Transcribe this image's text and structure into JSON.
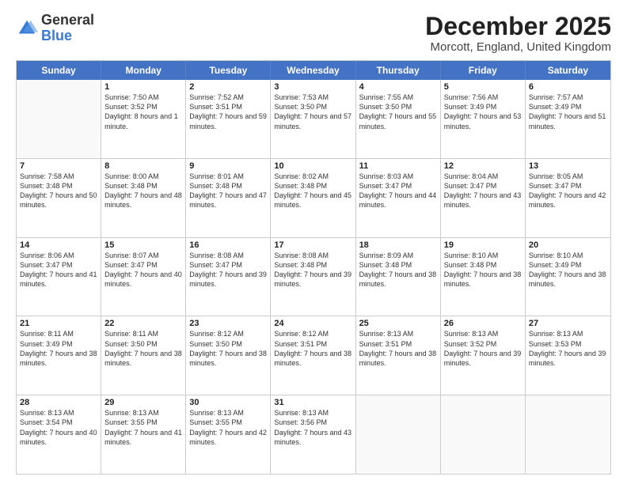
{
  "header": {
    "logo": {
      "general": "General",
      "blue": "Blue"
    },
    "title": "December 2025",
    "location": "Morcott, England, United Kingdom"
  },
  "days_of_week": [
    "Sunday",
    "Monday",
    "Tuesday",
    "Wednesday",
    "Thursday",
    "Friday",
    "Saturday"
  ],
  "weeks": [
    [
      {
        "day": "",
        "empty": true
      },
      {
        "day": "1",
        "sunrise": "Sunrise: 7:50 AM",
        "sunset": "Sunset: 3:52 PM",
        "daylight": "Daylight: 8 hours and 1 minute."
      },
      {
        "day": "2",
        "sunrise": "Sunrise: 7:52 AM",
        "sunset": "Sunset: 3:51 PM",
        "daylight": "Daylight: 7 hours and 59 minutes."
      },
      {
        "day": "3",
        "sunrise": "Sunrise: 7:53 AM",
        "sunset": "Sunset: 3:50 PM",
        "daylight": "Daylight: 7 hours and 57 minutes."
      },
      {
        "day": "4",
        "sunrise": "Sunrise: 7:55 AM",
        "sunset": "Sunset: 3:50 PM",
        "daylight": "Daylight: 7 hours and 55 minutes."
      },
      {
        "day": "5",
        "sunrise": "Sunrise: 7:56 AM",
        "sunset": "Sunset: 3:49 PM",
        "daylight": "Daylight: 7 hours and 53 minutes."
      },
      {
        "day": "6",
        "sunrise": "Sunrise: 7:57 AM",
        "sunset": "Sunset: 3:49 PM",
        "daylight": "Daylight: 7 hours and 51 minutes."
      }
    ],
    [
      {
        "day": "7",
        "sunrise": "Sunrise: 7:58 AM",
        "sunset": "Sunset: 3:48 PM",
        "daylight": "Daylight: 7 hours and 50 minutes."
      },
      {
        "day": "8",
        "sunrise": "Sunrise: 8:00 AM",
        "sunset": "Sunset: 3:48 PM",
        "daylight": "Daylight: 7 hours and 48 minutes."
      },
      {
        "day": "9",
        "sunrise": "Sunrise: 8:01 AM",
        "sunset": "Sunset: 3:48 PM",
        "daylight": "Daylight: 7 hours and 47 minutes."
      },
      {
        "day": "10",
        "sunrise": "Sunrise: 8:02 AM",
        "sunset": "Sunset: 3:48 PM",
        "daylight": "Daylight: 7 hours and 45 minutes."
      },
      {
        "day": "11",
        "sunrise": "Sunrise: 8:03 AM",
        "sunset": "Sunset: 3:47 PM",
        "daylight": "Daylight: 7 hours and 44 minutes."
      },
      {
        "day": "12",
        "sunrise": "Sunrise: 8:04 AM",
        "sunset": "Sunset: 3:47 PM",
        "daylight": "Daylight: 7 hours and 43 minutes."
      },
      {
        "day": "13",
        "sunrise": "Sunrise: 8:05 AM",
        "sunset": "Sunset: 3:47 PM",
        "daylight": "Daylight: 7 hours and 42 minutes."
      }
    ],
    [
      {
        "day": "14",
        "sunrise": "Sunrise: 8:06 AM",
        "sunset": "Sunset: 3:47 PM",
        "daylight": "Daylight: 7 hours and 41 minutes."
      },
      {
        "day": "15",
        "sunrise": "Sunrise: 8:07 AM",
        "sunset": "Sunset: 3:47 PM",
        "daylight": "Daylight: 7 hours and 40 minutes."
      },
      {
        "day": "16",
        "sunrise": "Sunrise: 8:08 AM",
        "sunset": "Sunset: 3:47 PM",
        "daylight": "Daylight: 7 hours and 39 minutes."
      },
      {
        "day": "17",
        "sunrise": "Sunrise: 8:08 AM",
        "sunset": "Sunset: 3:48 PM",
        "daylight": "Daylight: 7 hours and 39 minutes."
      },
      {
        "day": "18",
        "sunrise": "Sunrise: 8:09 AM",
        "sunset": "Sunset: 3:48 PM",
        "daylight": "Daylight: 7 hours and 38 minutes."
      },
      {
        "day": "19",
        "sunrise": "Sunrise: 8:10 AM",
        "sunset": "Sunset: 3:48 PM",
        "daylight": "Daylight: 7 hours and 38 minutes."
      },
      {
        "day": "20",
        "sunrise": "Sunrise: 8:10 AM",
        "sunset": "Sunset: 3:49 PM",
        "daylight": "Daylight: 7 hours and 38 minutes."
      }
    ],
    [
      {
        "day": "21",
        "sunrise": "Sunrise: 8:11 AM",
        "sunset": "Sunset: 3:49 PM",
        "daylight": "Daylight: 7 hours and 38 minutes."
      },
      {
        "day": "22",
        "sunrise": "Sunrise: 8:11 AM",
        "sunset": "Sunset: 3:50 PM",
        "daylight": "Daylight: 7 hours and 38 minutes."
      },
      {
        "day": "23",
        "sunrise": "Sunrise: 8:12 AM",
        "sunset": "Sunset: 3:50 PM",
        "daylight": "Daylight: 7 hours and 38 minutes."
      },
      {
        "day": "24",
        "sunrise": "Sunrise: 8:12 AM",
        "sunset": "Sunset: 3:51 PM",
        "daylight": "Daylight: 7 hours and 38 minutes."
      },
      {
        "day": "25",
        "sunrise": "Sunrise: 8:13 AM",
        "sunset": "Sunset: 3:51 PM",
        "daylight": "Daylight: 7 hours and 38 minutes."
      },
      {
        "day": "26",
        "sunrise": "Sunrise: 8:13 AM",
        "sunset": "Sunset: 3:52 PM",
        "daylight": "Daylight: 7 hours and 39 minutes."
      },
      {
        "day": "27",
        "sunrise": "Sunrise: 8:13 AM",
        "sunset": "Sunset: 3:53 PM",
        "daylight": "Daylight: 7 hours and 39 minutes."
      }
    ],
    [
      {
        "day": "28",
        "sunrise": "Sunrise: 8:13 AM",
        "sunset": "Sunset: 3:54 PM",
        "daylight": "Daylight: 7 hours and 40 minutes."
      },
      {
        "day": "29",
        "sunrise": "Sunrise: 8:13 AM",
        "sunset": "Sunset: 3:55 PM",
        "daylight": "Daylight: 7 hours and 41 minutes."
      },
      {
        "day": "30",
        "sunrise": "Sunrise: 8:13 AM",
        "sunset": "Sunset: 3:55 PM",
        "daylight": "Daylight: 7 hours and 42 minutes."
      },
      {
        "day": "31",
        "sunrise": "Sunrise: 8:13 AM",
        "sunset": "Sunset: 3:56 PM",
        "daylight": "Daylight: 7 hours and 43 minutes."
      },
      {
        "day": "",
        "empty": true
      },
      {
        "day": "",
        "empty": true
      },
      {
        "day": "",
        "empty": true
      }
    ]
  ]
}
